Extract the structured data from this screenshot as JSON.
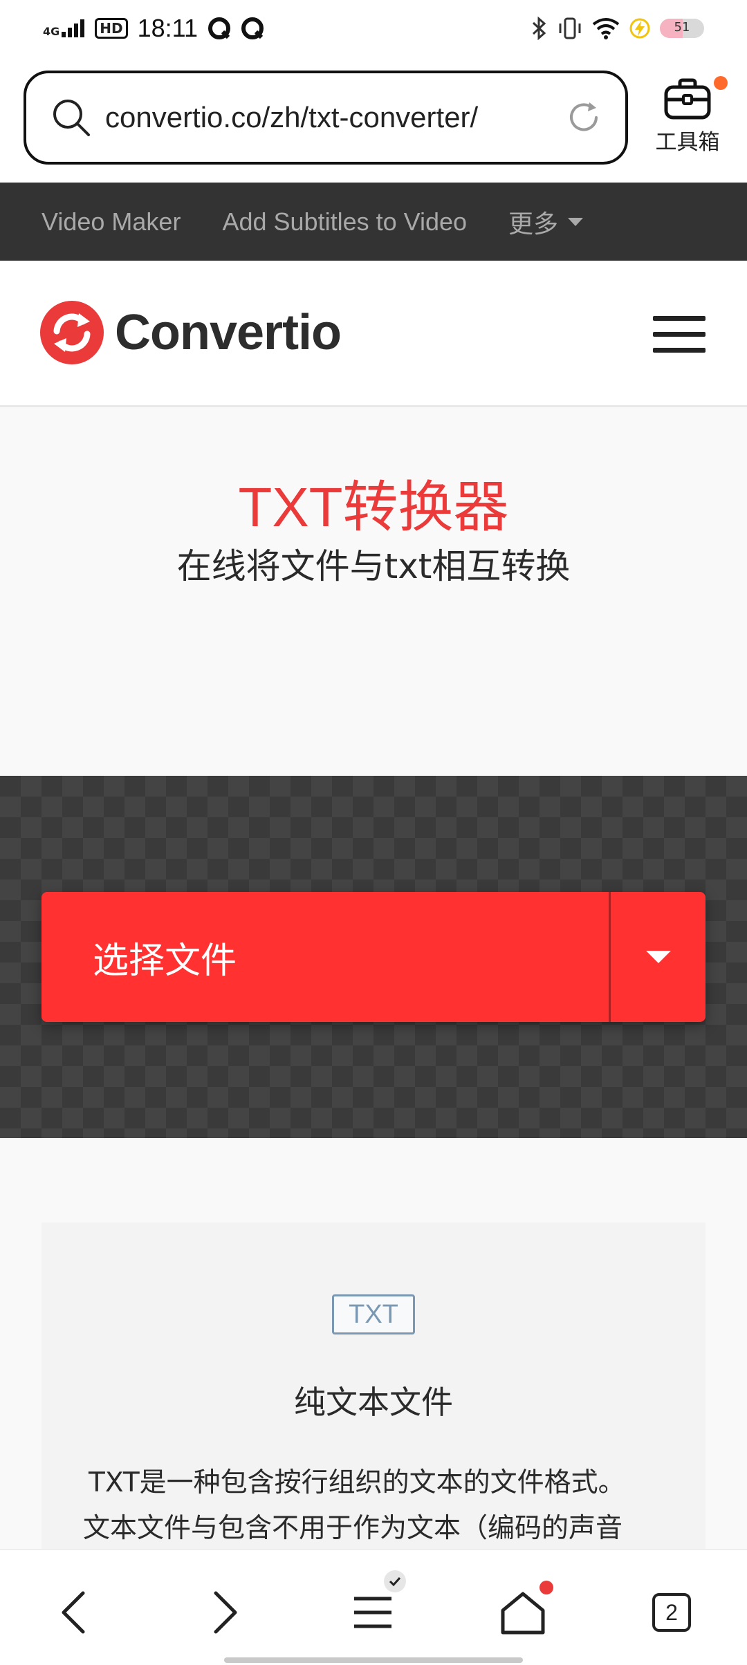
{
  "status_bar": {
    "network": "4G",
    "hd": "HD",
    "time": "18:11",
    "battery_level": 51,
    "battery_text": "51"
  },
  "browser": {
    "url": "convertio.co/zh/txt-converter/",
    "toolbox_label": "工具箱"
  },
  "site_nav": {
    "items": [
      "Video Maker",
      "Add Subtitles to Video"
    ],
    "more_label": "更多"
  },
  "header": {
    "logo_text": "Convertio",
    "brand_color": "#ea3a3a"
  },
  "hero": {
    "title": "TXT转换器",
    "subtitle": "在线将文件与txt相互转换"
  },
  "upload": {
    "choose_label": "选择文件",
    "button_color": "#ff3131"
  },
  "info_card": {
    "badge": "TXT",
    "title": "纯文本文件",
    "description_line1": "TXT是一种包含按行组织的文本的文件格式。",
    "description_line2": "文本文件与包含不用于作为文本（编码的声音"
  },
  "bottom_nav": {
    "tab_count": "2"
  }
}
